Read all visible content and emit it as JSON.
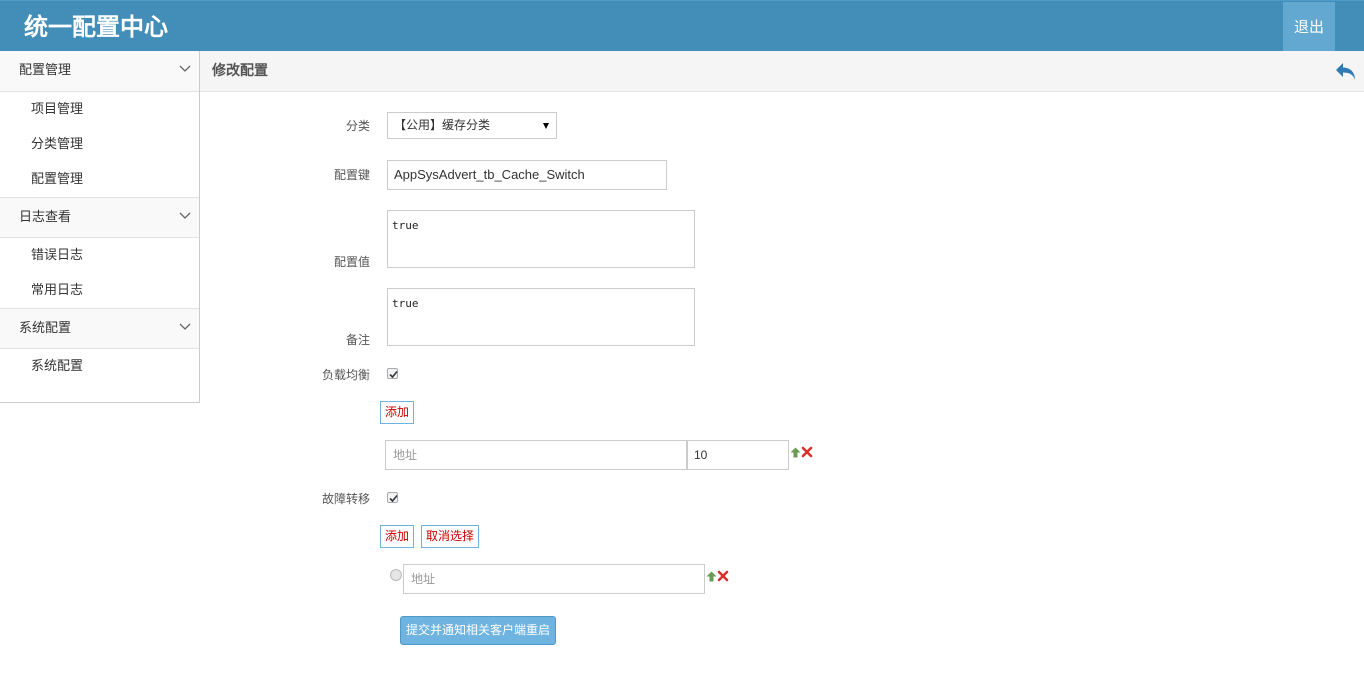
{
  "header": {
    "title": "统一配置中心",
    "logout_label": "退出"
  },
  "sidebar": {
    "groups": [
      {
        "label": "配置管理",
        "items": [
          "项目管理",
          "分类管理",
          "配置管理"
        ]
      },
      {
        "label": "日志查看",
        "items": [
          "错误日志",
          "常用日志"
        ]
      },
      {
        "label": "系统配置",
        "items": [
          "系统配置"
        ]
      }
    ]
  },
  "breadcrumb": {
    "title": "修改配置"
  },
  "form": {
    "category_label": "分类",
    "category_value": "【公用】缓存分类",
    "key_label": "配置键",
    "key_value": "AppSysAdvert_tb_Cache_Switch",
    "value_label": "配置值",
    "value_value": "true",
    "remark_label": "备注",
    "remark_value": "true",
    "load_balance_label": "负载均衡",
    "load_balance_checked": true,
    "add_label": "添加",
    "lb_address_placeholder": "地址",
    "lb_weight_value": "10",
    "failover_label": "故障转移",
    "failover_checked": true,
    "cancel_select_label": "取消选择",
    "fo_address_placeholder": "地址",
    "submit_label": "提交并通知相关客户端重启"
  },
  "colors": {
    "header_bg": "#438eb9",
    "logout_bg": "#62a8d1",
    "submit_bg": "#6fb3e0",
    "danger": "#cc0000"
  },
  "icons": [
    "chevron-down-icon",
    "back-arrow-icon",
    "arrow-up-icon",
    "delete-x-icon",
    "checkmark-icon"
  ]
}
